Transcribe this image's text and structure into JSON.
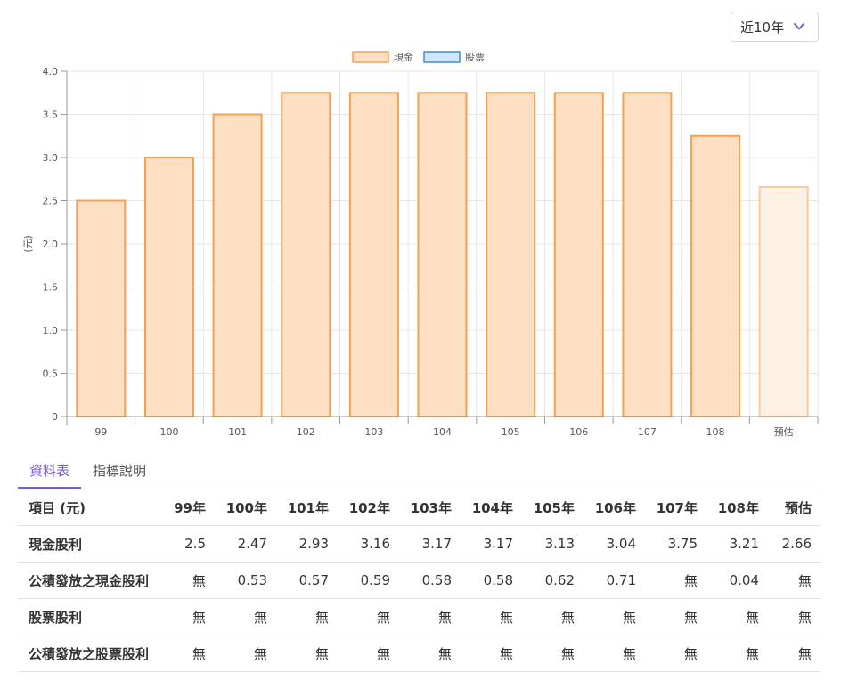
{
  "range_select": {
    "value": "近10年"
  },
  "tabs": [
    {
      "label": "資料表",
      "active": true
    },
    {
      "label": "指標說明",
      "active": false
    }
  ],
  "colors": {
    "cash_fill": "#fde0c4",
    "cash_stroke": "#f5a04e",
    "cash_estimate_fill": "#fef1e4",
    "cash_estimate_stroke": "#f9c99a",
    "stock_fill": "#cfe7fb",
    "stock_stroke": "#3a8fd8",
    "accent": "#7b5cd6"
  },
  "chart_data": {
    "type": "bar",
    "ylabel": "(元)",
    "ylim": [
      0,
      4.0
    ],
    "yticks": [
      "0",
      "0.5",
      "1.0",
      "1.5",
      "2.0",
      "2.5",
      "3.0",
      "3.5",
      "4.0"
    ],
    "categories": [
      "99",
      "100",
      "101",
      "102",
      "103",
      "104",
      "105",
      "106",
      "107",
      "108",
      "預估"
    ],
    "legend_position": "top-center",
    "grid": true,
    "series": [
      {
        "name": "現金",
        "values": [
          2.5,
          3.0,
          3.5,
          3.75,
          3.75,
          3.75,
          3.75,
          3.75,
          3.75,
          3.25,
          2.66
        ]
      },
      {
        "name": "股票",
        "values": [
          0,
          0,
          0,
          0,
          0,
          0,
          0,
          0,
          0,
          0,
          0
        ]
      }
    ]
  },
  "table": {
    "header": [
      "項目 (元)",
      "99年",
      "100年",
      "101年",
      "102年",
      "103年",
      "104年",
      "105年",
      "106年",
      "107年",
      "108年",
      "預估"
    ],
    "rows": [
      {
        "label": "現金股利",
        "cells": [
          "2.5",
          "2.47",
          "2.93",
          "3.16",
          "3.17",
          "3.17",
          "3.13",
          "3.04",
          "3.75",
          "3.21",
          "2.66"
        ]
      },
      {
        "label": "公積發放之現金股利",
        "cells": [
          "無",
          "0.53",
          "0.57",
          "0.59",
          "0.58",
          "0.58",
          "0.62",
          "0.71",
          "無",
          "0.04",
          "無"
        ]
      },
      {
        "label": "股票股利",
        "cells": [
          "無",
          "無",
          "無",
          "無",
          "無",
          "無",
          "無",
          "無",
          "無",
          "無",
          "無"
        ]
      },
      {
        "label": "公積發放之股票股利",
        "cells": [
          "無",
          "無",
          "無",
          "無",
          "無",
          "無",
          "無",
          "無",
          "無",
          "無",
          "無"
        ]
      }
    ]
  }
}
